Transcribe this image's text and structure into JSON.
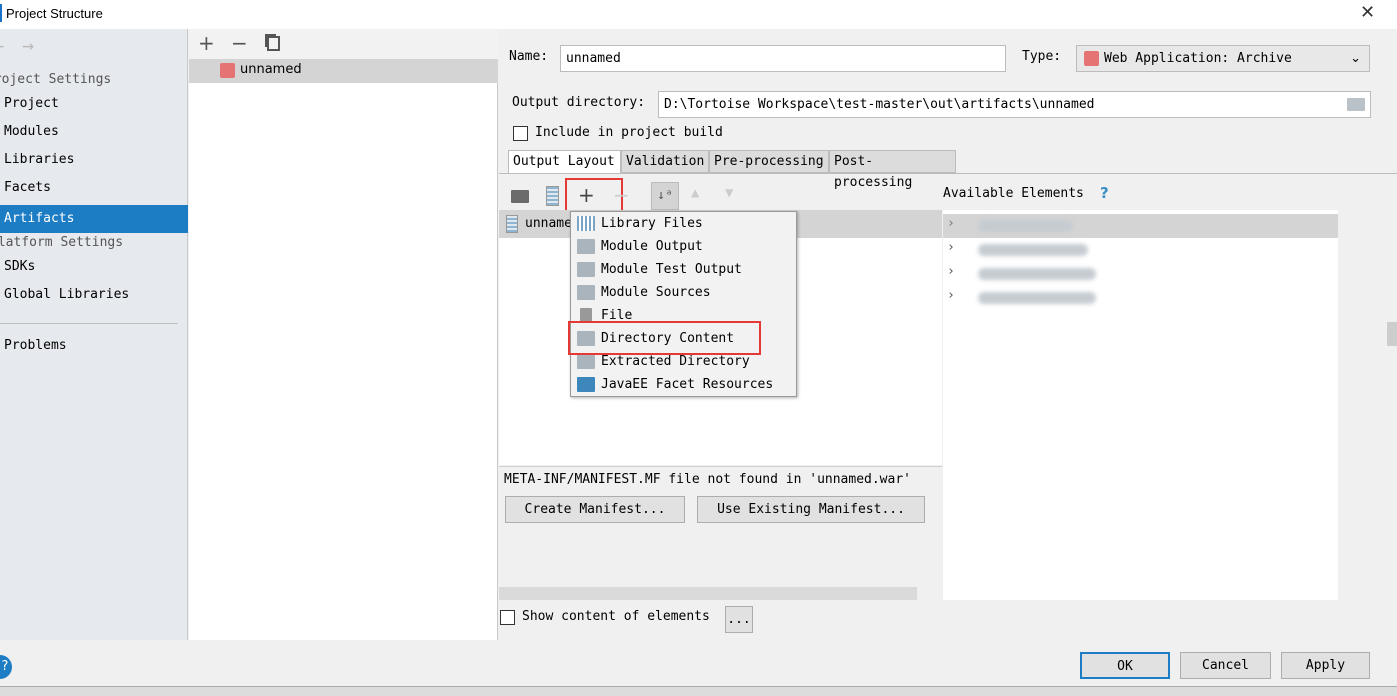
{
  "window": {
    "title": "Project Structure",
    "close_icon": "close-icon"
  },
  "sidebar": {
    "project_settings_header": "Project Settings",
    "project_items": [
      {
        "label": "Project"
      },
      {
        "label": "Modules"
      },
      {
        "label": "Libraries"
      },
      {
        "label": "Facets"
      },
      {
        "label": "Artifacts",
        "selected": true
      }
    ],
    "platform_settings_header": "Platform Settings",
    "platform_items": [
      {
        "label": "SDKs"
      },
      {
        "label": "Global Libraries"
      }
    ],
    "problems": "Problems"
  },
  "artifacts_list": {
    "items": [
      {
        "label": "unnamed",
        "selected": true
      }
    ]
  },
  "form": {
    "name_label": "Name:",
    "name_value": "unnamed",
    "type_label": "Type:",
    "type_value": "Web Application: Archive",
    "output_dir_label": "Output directory:",
    "output_dir_value": "D:\\Tortoise Workspace\\test-master\\out\\artifacts\\unnamed",
    "include_label": "Include in project build",
    "include_checked": false
  },
  "tabs": [
    {
      "label": "Output Layout",
      "selected": true
    },
    {
      "label": "Validation"
    },
    {
      "label": "Pre-processing"
    },
    {
      "label": "Post-processing"
    }
  ],
  "layout": {
    "root_item": "unnamed",
    "available_elements_label": "Available Elements",
    "help": "?",
    "manifest_warning": "META-INF/MANIFEST.MF file not found in 'unnamed.war'",
    "create_manifest": "Create Manifest...",
    "use_existing_manifest": "Use Existing Manifest...",
    "show_content_label": "Show content of elements",
    "ellipsis": "..."
  },
  "add_menu": {
    "items": [
      {
        "label": "Library Files",
        "icon": "library-icon"
      },
      {
        "label": "Module Output",
        "icon": "module-folder-icon"
      },
      {
        "label": "Module Test Output",
        "icon": "test-folder-icon"
      },
      {
        "label": "Module Sources",
        "icon": "source-folder-icon"
      },
      {
        "label": "File",
        "icon": "file-icon"
      },
      {
        "label": "Directory Content",
        "icon": "folder-icon",
        "highlighted": true
      },
      {
        "label": "Extracted Directory",
        "icon": "extract-icon"
      },
      {
        "label": "JavaEE Facet Resources",
        "icon": "javaee-icon"
      }
    ]
  },
  "footer": {
    "help": "?",
    "ok": "OK",
    "cancel": "Cancel",
    "apply": "Apply"
  },
  "colors": {
    "selection": "#1c7cc4",
    "highlight_box": "#e53935"
  }
}
